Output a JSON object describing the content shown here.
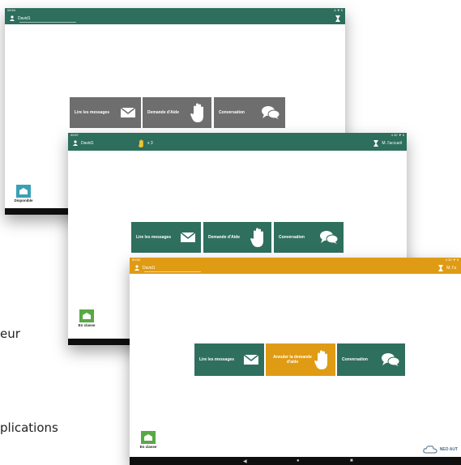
{
  "side_text": {
    "line1": "eur",
    "line2": "plications"
  },
  "colors": {
    "green": "#2d6e5c",
    "green_tile": "#2f6f5e",
    "grey_tile": "#6e6e6e",
    "orange": "#e09b14",
    "dock": "#3aa0b6"
  },
  "screen1": {
    "status_time": "09:54",
    "status_right": "4 ▼ 5",
    "user": "David1",
    "tiles": [
      {
        "label": "Lire les messages",
        "icon": "envelope-icon"
      },
      {
        "label": "Demande d'Aide",
        "icon": "hand-icon"
      },
      {
        "label": "Conversation",
        "icon": "chat-icon"
      }
    ],
    "dock_status": "Disponible"
  },
  "screen2": {
    "status_time": "09:57",
    "status_right": "4 32 ▼ 5",
    "user": "David1",
    "hand_count": "x 3",
    "right_label": "M. l'accueil",
    "tiles": [
      {
        "label": "Lire les messages",
        "icon": "envelope-icon"
      },
      {
        "label": "Demande d'Aide",
        "icon": "hand-icon"
      },
      {
        "label": "Conversation",
        "icon": "chat-icon"
      }
    ],
    "dock_status": "En classe"
  },
  "screen3": {
    "status_time": "09:55",
    "status_right": "4 32 ▼ 5",
    "user": "David1",
    "right_label": "M. l'a",
    "tiles": [
      {
        "label": "Lire les messages",
        "icon": "envelope-icon"
      },
      {
        "label": "Annuler la demande d'aide",
        "icon": "hand-icon"
      },
      {
        "label": "Conversation",
        "icon": "chat-icon"
      }
    ],
    "dock_status": "En classe",
    "logo_text": "NEO AUT"
  }
}
